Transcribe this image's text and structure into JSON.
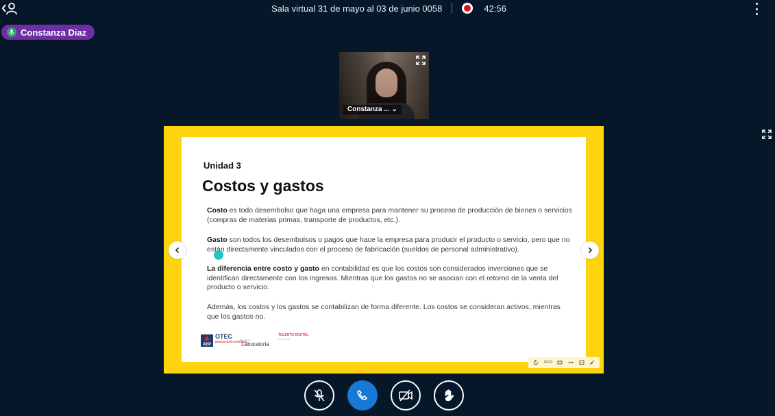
{
  "header": {
    "room_title": "Sala virtual 31 de mayo al 03 de junio 0058",
    "timer": "42:56",
    "back_icon": "chevron-left-user-icon",
    "menu_icon": "kebab-menu-icon",
    "record_color": "#e1121a"
  },
  "speaker": {
    "name": "Constanza Diaz",
    "icon": "microphone-icon",
    "badge_color": "#6f2fa4"
  },
  "webcam": {
    "name": "Constanza ...",
    "expand_icon": "expand-icon"
  },
  "slide": {
    "unit": "Unidad 3",
    "title": "Costos y gastos",
    "p1_bold": "Costo",
    "p1_text": " es todo desembolso que haga una empresa para mantener su proceso de producción de bienes o servicios (compras de materias primas, transporte de productos, etc.).",
    "p2_bold": "Gasto",
    "p2_text": " son todos los desembolsos o pagos que hace la empresa para producir el producto o servicio, pero que no están directamente vinculados con el proceso de fabricación (sueldos de personal administrativo).",
    "p3_bold": "La diferencia entre costo y gasto",
    "p3_text": " en contabilidad es que los costos son considerados inversiones que se identifican directamente con los ingresos. Mientras que los gastos no se asocian con el retorno de la venta del producto o servicio.",
    "p4_text": "Además, los costos y los gastos se contabilizan de forma diferente. Los costos se consideran activos, mientras que los gastos no.",
    "logos": {
      "aep": "AEP",
      "otec": "OTEC",
      "otec_sub": "EDUCACIÓN CONTINUA",
      "lab_tag": "Miembro de",
      "lab": "Laboratoria",
      "talento": "TALENTO DIGITAL",
      "talento_sub": "PARA CHILE"
    },
    "frame_color": "#fdd40d"
  },
  "presentation_toolbar": {
    "page": "16/32"
  },
  "controls": {
    "mute_label": "mic-off-icon",
    "hangup_label": "phone-icon",
    "camera_label": "camera-off-icon",
    "hand_label": "raise-hand-icon",
    "primary_color": "#1878d6"
  }
}
